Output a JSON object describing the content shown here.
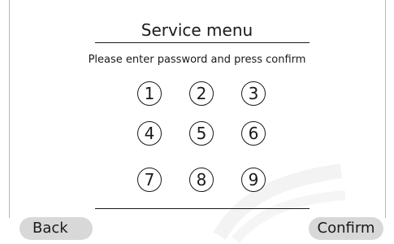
{
  "title": "Service menu",
  "instruction": "Please enter password and press confirm",
  "keypad": {
    "keys": [
      "1",
      "2",
      "3",
      "4",
      "5",
      "6",
      "7",
      "8",
      "9"
    ]
  },
  "footer": {
    "back_label": "Back",
    "confirm_label": "Confirm"
  },
  "colors": {
    "text": "#1a1a1a",
    "button_bg": "#d8d8d8",
    "background": "#ffffff"
  }
}
